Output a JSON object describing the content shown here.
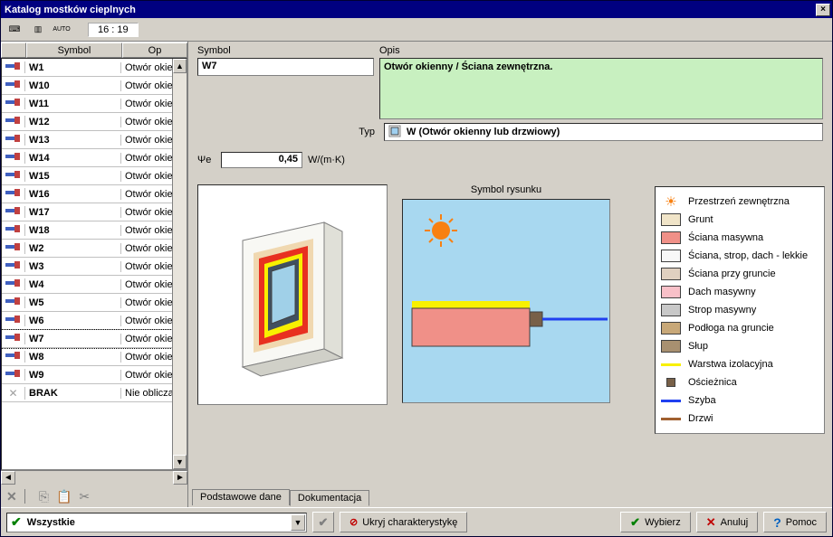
{
  "window": {
    "title": "Katalog mostków cieplnych"
  },
  "toolbar": {
    "clock": "16 : 19",
    "auto": "AUTO"
  },
  "grid": {
    "col_symbol": "Symbol",
    "col_desc": "Op",
    "rows": [
      {
        "sym": "W1",
        "desc": "Otwór okienn"
      },
      {
        "sym": "W10",
        "desc": "Otwór okienn"
      },
      {
        "sym": "W11",
        "desc": "Otwór okienn"
      },
      {
        "sym": "W12",
        "desc": "Otwór okienn"
      },
      {
        "sym": "W13",
        "desc": "Otwór okienn"
      },
      {
        "sym": "W14",
        "desc": "Otwór okienn"
      },
      {
        "sym": "W15",
        "desc": "Otwór okienn"
      },
      {
        "sym": "W16",
        "desc": "Otwór okienn"
      },
      {
        "sym": "W17",
        "desc": "Otwór okienn"
      },
      {
        "sym": "W18",
        "desc": "Otwór okienn"
      },
      {
        "sym": "W2",
        "desc": "Otwór okienn"
      },
      {
        "sym": "W3",
        "desc": "Otwór okienn"
      },
      {
        "sym": "W4",
        "desc": "Otwór okienn"
      },
      {
        "sym": "W5",
        "desc": "Otwór okienn"
      },
      {
        "sym": "W6",
        "desc": "Otwór okienn"
      },
      {
        "sym": "W7",
        "desc": "Otwór okienn"
      },
      {
        "sym": "W8",
        "desc": "Otwór okienn"
      },
      {
        "sym": "W9",
        "desc": "Otwór okienn"
      },
      {
        "sym": "BRAK",
        "desc": "Nie obliczaj r"
      }
    ]
  },
  "details": {
    "symbol_label": "Symbol",
    "symbol_value": "W7",
    "desc_label": "Opis",
    "desc_value": "Otwór okienny / Ściana zewnętrzna.",
    "typ_label": "Typ",
    "typ_value": "W (Otwór okienny lub drzwiowy)",
    "psi_label": "Ψe",
    "psi_value": "0,45",
    "psi_unit": "W/(m·K)",
    "drawing_title": "Symbol rysunku"
  },
  "legend": {
    "items": [
      {
        "label": "Przestrzeń zewnętrzna",
        "type": "sun"
      },
      {
        "label": "Grunt",
        "type": "box",
        "color": "#f0e4c8"
      },
      {
        "label": "Ściana masywna",
        "type": "box",
        "color": "#f09088"
      },
      {
        "label": "Ściana, strop, dach - lekkie",
        "type": "box",
        "color": "#f8f8f8"
      },
      {
        "label": "Ściana przy gruncie",
        "type": "box",
        "color": "#e0d0c0"
      },
      {
        "label": "Dach masywny",
        "type": "box",
        "color": "#f8c0c8"
      },
      {
        "label": "Strop masywny",
        "type": "box",
        "color": "#c8c8c8"
      },
      {
        "label": "Podłoga na gruncie",
        "type": "box",
        "color": "#c8a878"
      },
      {
        "label": "Słup",
        "type": "box",
        "color": "#a89070"
      },
      {
        "label": "Warstwa izolacyjna",
        "type": "line",
        "color": "#f8f000"
      },
      {
        "label": "Ościeżnica",
        "type": "smallbox",
        "color": "#786048"
      },
      {
        "label": "Szyba",
        "type": "line",
        "color": "#2040f0"
      },
      {
        "label": "Drzwi",
        "type": "line",
        "color": "#a06030"
      }
    ]
  },
  "tabs": {
    "tab1": "Podstawowe dane",
    "tab2": "Dokumentacja"
  },
  "bottom": {
    "filter": "Wszystkie",
    "hide": "Ukryj charakterystykę",
    "select": "Wybierz",
    "cancel": "Anuluj",
    "help": "Pomoc"
  }
}
